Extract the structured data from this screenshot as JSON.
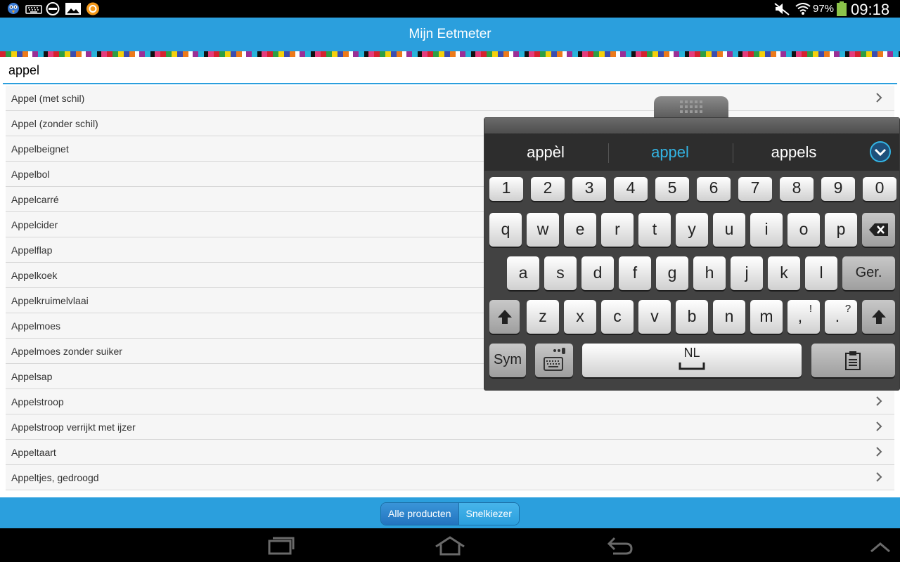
{
  "status_bar": {
    "icons": [
      "bird-app-icon",
      "keyboard-icon",
      "do-not-disturb-icon",
      "gallery-icon",
      "orange-app-icon",
      "mute-icon",
      "wifi-icon",
      "battery-icon"
    ],
    "battery": "97%",
    "time": "09:18"
  },
  "app": {
    "title": "Mijn Eetmeter"
  },
  "search": {
    "value": "appel"
  },
  "results": [
    {
      "label": "Appel (met schil)"
    },
    {
      "label": "Appel (zonder schil)"
    },
    {
      "label": "Appelbeignet"
    },
    {
      "label": "Appelbol"
    },
    {
      "label": "Appelcarré"
    },
    {
      "label": "Appelcider"
    },
    {
      "label": "Appelflap"
    },
    {
      "label": "Appelkoek"
    },
    {
      "label": "Appelkruimelvlaai"
    },
    {
      "label": "Appelmoes"
    },
    {
      "label": "Appelmoes zonder suiker"
    },
    {
      "label": "Appelsap"
    },
    {
      "label": "Appelstroop"
    },
    {
      "label": "Appelstroop verrijkt met ijzer"
    },
    {
      "label": "Appeltaart"
    },
    {
      "label": "Appeltjes, gedroogd"
    }
  ],
  "tabs": {
    "all_products": "Alle producten",
    "quick_picker": "Snelkiezer"
  },
  "keyboard": {
    "suggestions": [
      "appèl",
      "appel",
      "appels"
    ],
    "selected_suggestion": "appel",
    "number_row": [
      "1",
      "2",
      "3",
      "4",
      "5",
      "6",
      "7",
      "8",
      "9",
      "0"
    ],
    "row1": [
      "q",
      "w",
      "e",
      "r",
      "t",
      "y",
      "u",
      "i",
      "o",
      "p"
    ],
    "row2": [
      "a",
      "s",
      "d",
      "f",
      "g",
      "h",
      "j",
      "k",
      "l"
    ],
    "row3": [
      "z",
      "x",
      "c",
      "v",
      "b",
      "n",
      "m"
    ],
    "comma_key": {
      "main": ",",
      "alt": "!"
    },
    "period_key": {
      "main": ".",
      "alt": "?"
    },
    "enter_label": "Ger.",
    "sym_label": "Sym",
    "space_label": "NL"
  },
  "colors": {
    "accent": "#2b9fdd",
    "suggestion_highlight": "#33b5e5"
  }
}
